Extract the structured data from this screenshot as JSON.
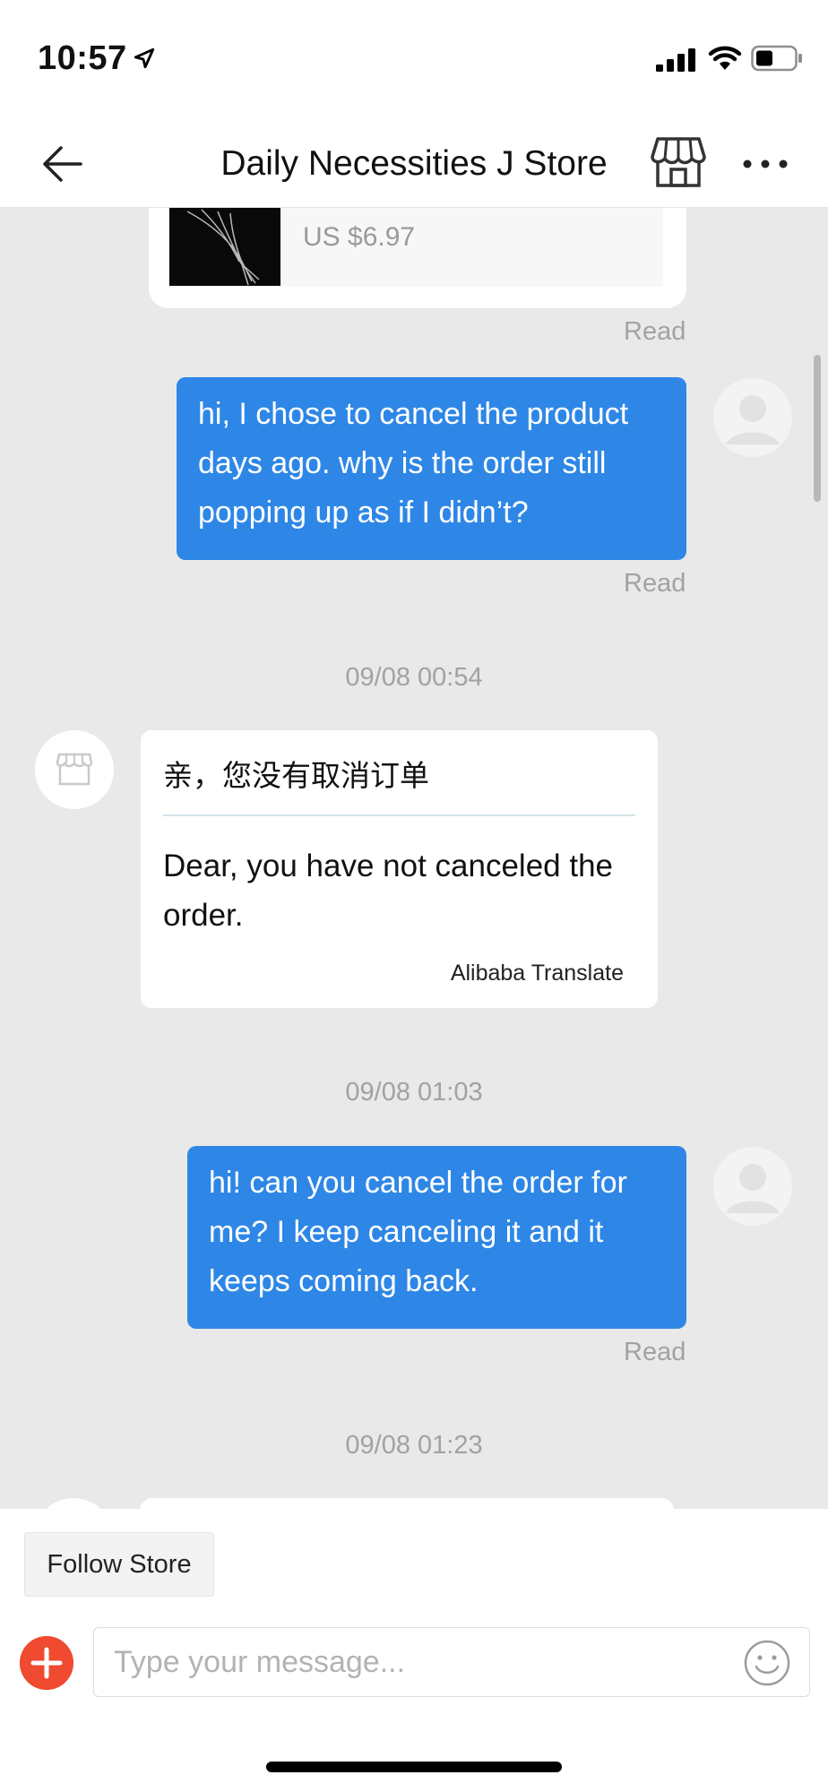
{
  "status_bar": {
    "time": "10:57"
  },
  "nav": {
    "title": "Daily Necessities J Store"
  },
  "product": {
    "price": "US $6.97"
  },
  "messages": [
    {
      "type": "outgoing",
      "read": "Read"
    },
    {
      "type": "outgoing",
      "text": "hi, I chose to cancel the product days ago. why is the order still popping up as if I didn’t?",
      "read": "Read"
    },
    {
      "type": "timestamp",
      "text": "09/08 00:54"
    },
    {
      "type": "incoming",
      "original": "亲，您没有取消订单",
      "translation": "Dear, you have not canceled the order.",
      "translator": "Alibaba Translate"
    },
    {
      "type": "timestamp",
      "text": "09/08 01:03"
    },
    {
      "type": "outgoing",
      "text": "hi! can you cancel the order for me? I keep canceling it and it keeps coming back.",
      "read": "Read"
    },
    {
      "type": "timestamp",
      "text": "09/08 01:23"
    }
  ],
  "bottom": {
    "follow_label": "Follow Store",
    "input_placeholder": "Type your message..."
  },
  "colors": {
    "outgoing_bubble": "#2e87e6",
    "add_button": "#f04a30",
    "chat_background": "#e9e9e9"
  },
  "icons": [
    "location-arrow-icon",
    "signal-icon",
    "wifi-icon",
    "battery-icon",
    "back-arrow-icon",
    "store-icon",
    "more-dots-icon",
    "plus-icon",
    "emoji-icon"
  ]
}
